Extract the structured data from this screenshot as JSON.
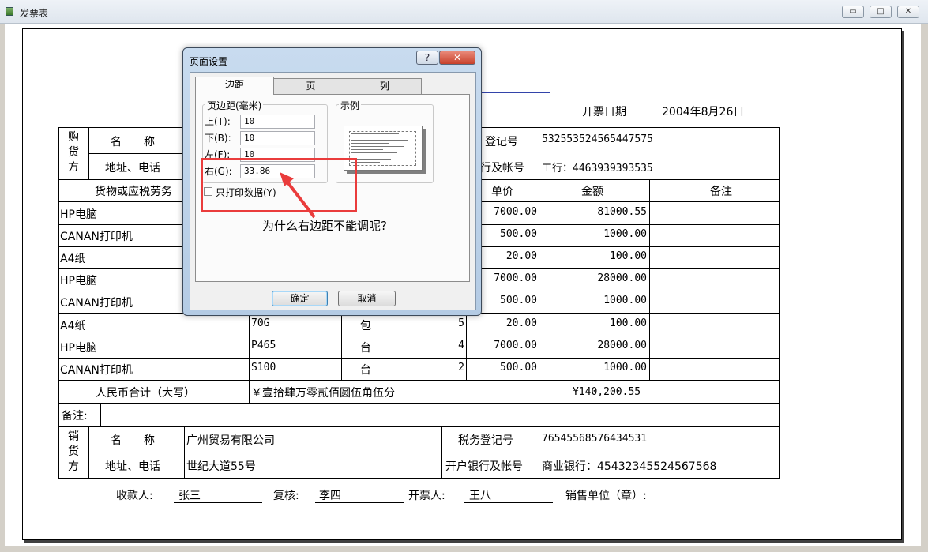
{
  "window": {
    "title": "发票表",
    "buttons": {
      "minimize": "▭",
      "maximize": "□",
      "close": "✕"
    }
  },
  "invoice": {
    "date_label": "开票日期",
    "date_value": "2004年8月26日",
    "buyer": {
      "label": [
        "购",
        "货",
        "方"
      ],
      "name_label": "名　　称",
      "address_label": "地址、电话",
      "tax_label": "登记号",
      "tax_value": "532553524565447575",
      "bank_label": "行及帐号",
      "bank_value": "工行：4463939393535"
    },
    "headers": {
      "goods": "货物或应税劳务",
      "price": "单价",
      "amount": "金额",
      "remark": "备注"
    },
    "rows": [
      {
        "name": "HP电脑",
        "spec": "",
        "unit": "",
        "qty": "",
        "price": "7000.00",
        "amount": "81000.55"
      },
      {
        "name": "CANAN打印机",
        "spec": "",
        "unit": "",
        "qty": "",
        "price": "500.00",
        "amount": "1000.00"
      },
      {
        "name": "A4纸",
        "spec": "",
        "unit": "",
        "qty": "",
        "price": "20.00",
        "amount": "100.00"
      },
      {
        "name": "HP电脑",
        "spec": "",
        "unit": "",
        "qty": "",
        "price": "7000.00",
        "amount": "28000.00"
      },
      {
        "name": "CANAN打印机",
        "spec": "",
        "unit": "",
        "qty": "",
        "price": "500.00",
        "amount": "1000.00"
      },
      {
        "name": "A4纸",
        "spec": "70G",
        "unit": "包",
        "qty": "5",
        "price": "20.00",
        "amount": "100.00"
      },
      {
        "name": "HP电脑",
        "spec": "P465",
        "unit": "台",
        "qty": "4",
        "price": "7000.00",
        "amount": "28000.00"
      },
      {
        "name": "CANAN打印机",
        "spec": "S100",
        "unit": "台",
        "qty": "2",
        "price": "500.00",
        "amount": "1000.00"
      }
    ],
    "total_label": "人民币合计（大写）",
    "total_words": "￥壹拾肆万零贰佰圆伍角伍分",
    "total_amount": "¥140,200.55",
    "remarks_label": "备注:",
    "seller": {
      "label": [
        "销",
        "货",
        "方"
      ],
      "name_label": "名　　称",
      "name_value": "广州贸易有限公司",
      "tax_label": "税务登记号",
      "tax_value": "76545568576434531",
      "address_label": "地址、电话",
      "address_value": "世纪大道55号",
      "bank_label": "开户银行及帐号",
      "bank_value": "商业银行：45432345524567568"
    },
    "footer": {
      "payee_label": "收款人:",
      "payee_value": "张三",
      "reviewer_label": "复核:",
      "reviewer_value": "李四",
      "drawer_label": "开票人:",
      "drawer_value": "王八",
      "seal_label": "销售单位（章）:"
    }
  },
  "dialog": {
    "title": "页面设置",
    "help": "?",
    "close": "✕",
    "tabs": [
      "边距",
      "页",
      "列"
    ],
    "margins_group": "页边距(毫米)",
    "sample_group": "示例",
    "top_label": "上(T):",
    "top_value": "10",
    "bottom_label": "下(B):",
    "bottom_value": "10",
    "left_label": "左(F):",
    "left_value": "10",
    "right_label": "右(G):",
    "right_value": "33.86",
    "print_data_only": "只打印数据(Y)",
    "ok": "确定",
    "cancel": "取消"
  },
  "annotation": {
    "callout_text": "为什么右边距不能调呢?",
    "highlight_color": "#ea3c3c"
  }
}
